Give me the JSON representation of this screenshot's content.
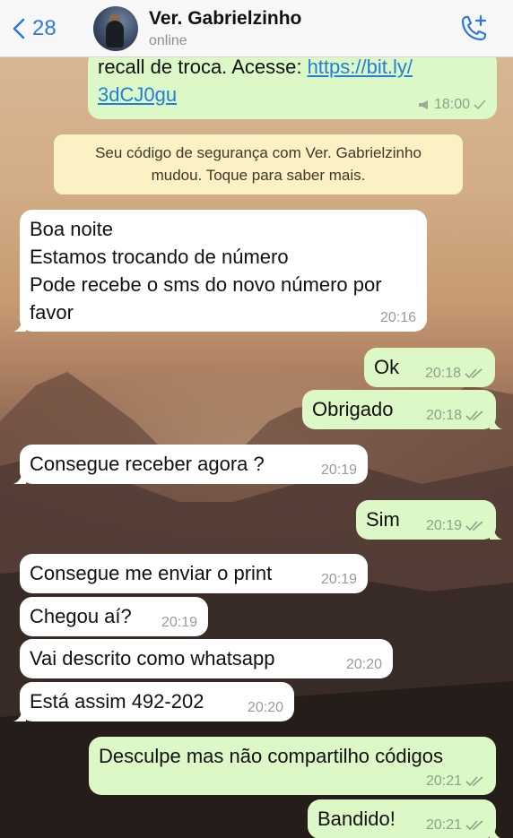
{
  "header": {
    "back_count": "28",
    "contact_name": "Ver. Gabrielzinho",
    "status": "online"
  },
  "messages": [
    {
      "direction": "out",
      "line1_text": "recall de troca. Acesse: ",
      "line1_link": "https://bit.ly/",
      "line2_link": "3dCJ0gu",
      "time": "18:00"
    },
    {
      "direction": "system",
      "line1": "Seu código de segurança com Ver. Gabrielzinho",
      "line2": "mudou. Toque para saber mais."
    },
    {
      "direction": "in",
      "lines": [
        "Boa noite",
        "Estamos trocando de número",
        "Pode recebe o sms do novo número por",
        "favor"
      ],
      "time": "20:16"
    },
    {
      "direction": "out",
      "text": "Ok",
      "time": "20:18"
    },
    {
      "direction": "out",
      "text": "Obrigado",
      "time": "20:18"
    },
    {
      "direction": "in",
      "text": "Consegue receber agora ?",
      "time": "20:19"
    },
    {
      "direction": "out",
      "text": "Sim",
      "time": "20:19"
    },
    {
      "direction": "in",
      "text": "Consegue me enviar o print",
      "time": "20:19"
    },
    {
      "direction": "in",
      "text": "Chegou aí?",
      "time": "20:19"
    },
    {
      "direction": "in",
      "text": "Vai descrito como whatsapp",
      "time": "20:20"
    },
    {
      "direction": "in",
      "text": "Está assim 492-202",
      "time": "20:20"
    },
    {
      "direction": "out",
      "text": "Desculpe mas não compartilho códigos",
      "time": "20:21"
    },
    {
      "direction": "out",
      "text": "Bandido!",
      "time": "20:21"
    }
  ],
  "icons": {
    "back": "chevron-left-icon",
    "call": "phone-add-icon",
    "read": "double-check-icon",
    "sent": "single-check-icon",
    "broadcast": "megaphone-icon"
  },
  "colors": {
    "accent": "#2f7ad8",
    "outgoing_bubble": "#dcf8c6",
    "incoming_bubble": "#ffffff",
    "system_bubble": "#fbf1c5",
    "read_ticks": "#8aa38a"
  }
}
